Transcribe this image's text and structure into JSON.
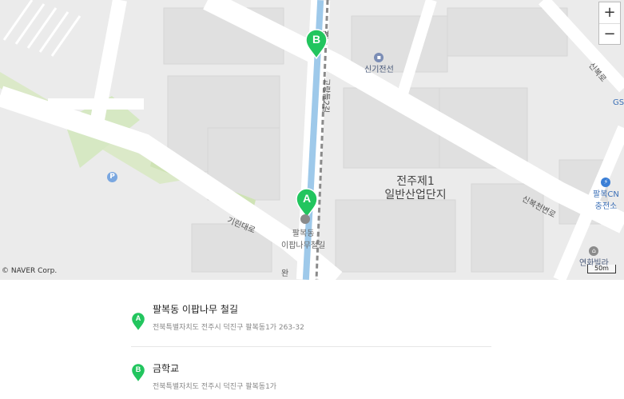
{
  "map": {
    "district_name_line1": "전주제1",
    "district_name_line2": "일반산업단지",
    "poi_sinki": "신기전선",
    "poi_gs": "GS",
    "poi_charge_line1": "팔복CN",
    "poi_charge_line2": "충전소",
    "poi_villa": "연화빌라",
    "parking_symbol": "P",
    "road_giji": "기린대로",
    "road_sinbok_1": "신복로",
    "road_sinbok_2": "신복천변로",
    "road_vertical": "고랑들2길",
    "road_vertical_bottom": "완",
    "road_vertical_top": "길",
    "marker_a_label_line1": "팔복동",
    "marker_a_label_line2": "이팝나무철길",
    "copyright": "© NAVER Corp.",
    "scale_label": "50m",
    "zoom_in": "+",
    "zoom_out": "−",
    "marker_color": "#22c55e"
  },
  "places": [
    {
      "letter": "A",
      "name": "팔복동 이팝나무 철길",
      "address": "전북특별자치도 전주시 덕진구 팔복동1가 263-32"
    },
    {
      "letter": "B",
      "name": "금학교",
      "address": "전북특별자치도 전주시 덕진구 팔복동1가"
    }
  ]
}
